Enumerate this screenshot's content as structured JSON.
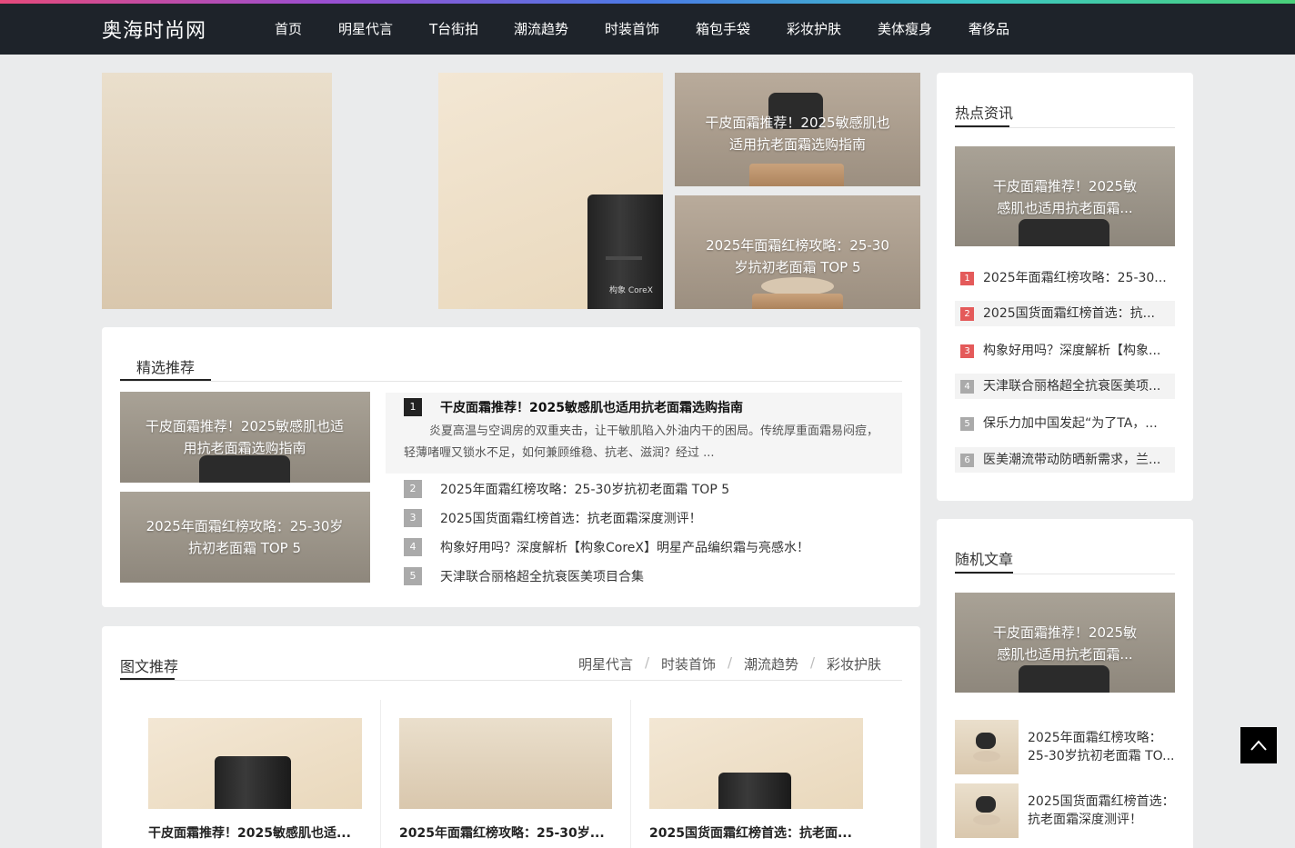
{
  "site": {
    "logo": "奥海时尚网"
  },
  "nav": [
    "首页",
    "明星代言",
    "T台街拍",
    "潮流趋势",
    "时装首饰",
    "箱包手袋",
    "彩妆护肤",
    "美体瘦身",
    "奢侈品"
  ],
  "banner": {
    "side_captions": [
      "干皮面霜推荐！2025敏感肌也适用抗老面霜选购指南",
      "2025年面霜红榜攻略：25-30岁抗初老面霜 TOP 5"
    ],
    "product_logo": "构象 CoreX"
  },
  "featured": {
    "title": "精选推荐",
    "cards": [
      "干皮面霜推荐！2025敏感肌也适用抗老面霜选购指南",
      "2025年面霜红榜攻略：25-30岁抗初老面霜 TOP 5"
    ],
    "top": {
      "num": "1",
      "title": "干皮面霜推荐！2025敏感肌也适用抗老面霜选购指南",
      "excerpt": "炎夏高温与空调房的双重夹击，让干敏肌陷入外油内干的困局。传统厚重面霜易闷痘，轻薄啫喱又锁水不足，如何兼顾维稳、抗老、滋润？经过 ..."
    },
    "list": [
      {
        "num": "2",
        "title": "2025年面霜红榜攻略：25-30岁抗初老面霜 TOP 5"
      },
      {
        "num": "3",
        "title": "2025国货面霜红榜首选：抗老面霜深度测评！"
      },
      {
        "num": "4",
        "title": "构象好用吗？深度解析【构象CoreX】明星产品编织霜与亮感水！"
      },
      {
        "num": "5",
        "title": "天津联合丽格超全抗衰医美项目合集"
      }
    ]
  },
  "gallery": {
    "title": "图文推荐",
    "tabs": [
      "明星代言",
      "时装首饰",
      "潮流趋势",
      "彩妆护肤"
    ],
    "separator": "/",
    "cards": [
      "干皮面霜推荐！2025敏感肌也适...",
      "2025年面霜红榜攻略：25-30岁...",
      "2025国货面霜红榜首选：抗老面..."
    ]
  },
  "hot": {
    "title": "热点资讯",
    "feature": "干皮面霜推荐！2025敏感肌也适用抗老面霜...",
    "items": [
      {
        "num": "1",
        "text": "2025年面霜红榜攻略：25-30..."
      },
      {
        "num": "2",
        "text": "2025国货面霜红榜首选：抗..."
      },
      {
        "num": "3",
        "text": "构象好用吗？深度解析【构象..."
      },
      {
        "num": "4",
        "text": "天津联合丽格超全抗衰医美项..."
      },
      {
        "num": "5",
        "text": "保乐力加中国发起“为了TA，..."
      },
      {
        "num": "6",
        "text": "医美潮流带动防晒新需求，兰..."
      }
    ]
  },
  "random": {
    "title": "随机文章",
    "feature": "干皮面霜推荐！2025敏感肌也适用抗老面霜...",
    "items": [
      {
        "line1": "2025年面霜红榜攻略：",
        "line2": "25-30岁抗初老面霜 TO..."
      },
      {
        "line1": "2025国货面霜红榜首选：",
        "line2": "抗老面霜深度测评！"
      }
    ]
  },
  "colors": {
    "topbar": "#1e232a",
    "accent_red": "#e45a5a",
    "rank_grey": "#aaaaaa",
    "rank_dark": "#222222"
  },
  "icons": {
    "back_to_top": "chevron-up-icon"
  }
}
